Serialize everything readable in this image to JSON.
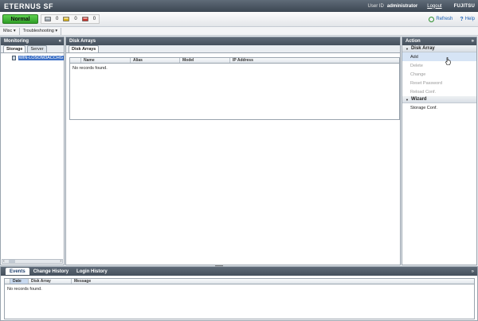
{
  "header": {
    "app_title": "ETERNUS SF",
    "user_id_label": "User ID",
    "user_id": "administrator",
    "logout": "Logout",
    "brand": "FUJITSU"
  },
  "statusbar": {
    "status": "Normal",
    "counts": [
      {
        "icon": "info-status-icon",
        "value": "0"
      },
      {
        "icon": "warning-status-icon",
        "value": "0"
      },
      {
        "icon": "error-status-icon",
        "value": "0"
      }
    ],
    "refresh": "Refresh",
    "help": "Help"
  },
  "menubar": {
    "items": [
      "Misc ▾",
      "Troubleshooting ▾"
    ]
  },
  "left": {
    "title": "Monitoring",
    "collapse": "«",
    "tabs": [
      "Storage",
      "Server"
    ],
    "tree_item": "WIN-LOSOM3ACCHG"
  },
  "center": {
    "title": "Disk Arrays",
    "tab": "Disk Arrays",
    "columns": [
      "Name",
      "Alias",
      "Model",
      "IP Address"
    ],
    "empty": "No records found."
  },
  "right": {
    "title": "Action",
    "collapse": "»",
    "sections": [
      {
        "title": "Disk Array",
        "items": [
          "Add",
          "Delete",
          "Change",
          "Reset Password",
          "Reload Conf."
        ]
      },
      {
        "title": "Wizard",
        "items": [
          "Storage Conf."
        ]
      }
    ]
  },
  "bottom": {
    "tabs": [
      "Events",
      "Change History",
      "Login History"
    ],
    "collapse": "»",
    "columns": [
      "Date",
      "Disk Array",
      "Message"
    ],
    "empty": "No records found."
  },
  "colors": {
    "header": "#45505c",
    "status_ok": "#2f9f27",
    "selection": "#3b6fc6",
    "hover": "#d6e4f5"
  }
}
